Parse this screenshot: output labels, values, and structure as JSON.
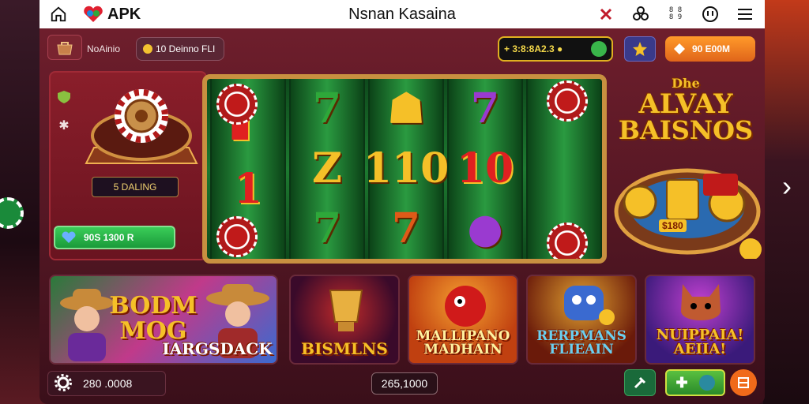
{
  "topbar": {
    "brand": "APK",
    "title": "Nsnan Kasaina",
    "right_icons": [
      "shield-icon",
      "flower-icon",
      "grid-icon",
      "clock-icon",
      "menu-icon"
    ],
    "grid_text": "8 8\n8 9"
  },
  "header": {
    "left_label": "NoAinio",
    "mid_pill": "10 Deinno FLI",
    "balance": "+ 3:8:8A2.3 ●",
    "orange_btn": "90 E00M"
  },
  "left_panel": {
    "label": "5 DALING",
    "green_btn": "90S 1300 R"
  },
  "promo": {
    "line1": "Dhe",
    "line2": "ALVAY",
    "line3": "BAISNOS",
    "badge": "$180"
  },
  "reels": {
    "symbols": [
      [
        "▌",
        "1",
        ""
      ],
      [
        "7",
        "Z",
        "7"
      ],
      [
        "☗",
        "110",
        "7"
      ],
      [
        "7",
        "10",
        "●"
      ],
      [
        "",
        "",
        ""
      ]
    ]
  },
  "tiles": [
    {
      "title": "BODM MOG",
      "subtitle": "IARGSDACK"
    },
    {
      "title": "BISMLNS"
    },
    {
      "title": "MALLIPANO MADHAIN"
    },
    {
      "title": "RERPMANS FLIEAIN"
    },
    {
      "title": "NUIPPAIA! AEIIA!"
    }
  ],
  "bottom": {
    "left_value": "280 .0008",
    "mid_value": "265,1000"
  },
  "colors": {
    "frame": "#6e1e2c",
    "gold": "#f5c028",
    "green": "#2ea83a",
    "orange": "#e0651a"
  }
}
